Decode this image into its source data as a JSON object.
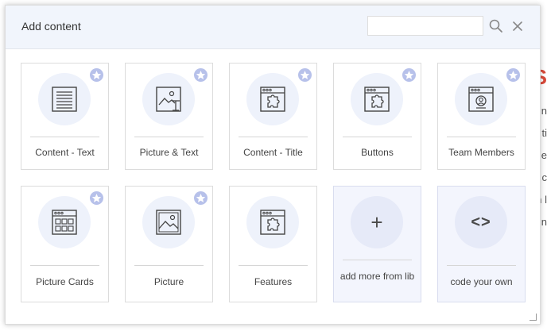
{
  "modal": {
    "title": "Add content",
    "search": {
      "value": "",
      "placeholder": ""
    }
  },
  "cards": [
    {
      "label": "Content - Text",
      "icon": "text-block-icon",
      "star": true
    },
    {
      "label": "Picture & Text",
      "icon": "picture-text-icon",
      "star": true
    },
    {
      "label": "Content - Title",
      "icon": "puzzle-window-icon",
      "star": true
    },
    {
      "label": "Buttons",
      "icon": "puzzle-window-icon",
      "star": true
    },
    {
      "label": "Team Members",
      "icon": "person-window-icon",
      "star": true
    },
    {
      "label": "Picture Cards",
      "icon": "cards-window-icon",
      "star": true
    },
    {
      "label": "Picture",
      "icon": "picture-icon",
      "star": true
    },
    {
      "label": "Features",
      "icon": "puzzle-window-icon",
      "star": false
    },
    {
      "label": "add more from lib",
      "icon": "plus-icon",
      "glyph": "+",
      "star": false
    },
    {
      "label": "code your own",
      "icon": "code-icon",
      "glyph": "<>",
      "star": false
    }
  ],
  "background": {
    "chars": [
      "n",
      "ti",
      "e",
      "c",
      "n l",
      "n"
    ],
    "red_char": "S"
  },
  "colors": {
    "header_bg": "#f1f5fc",
    "icon_circle": "#eef2fb",
    "star_badge": "#b7c1ea",
    "lib_card_bg": "#f3f5fd"
  }
}
